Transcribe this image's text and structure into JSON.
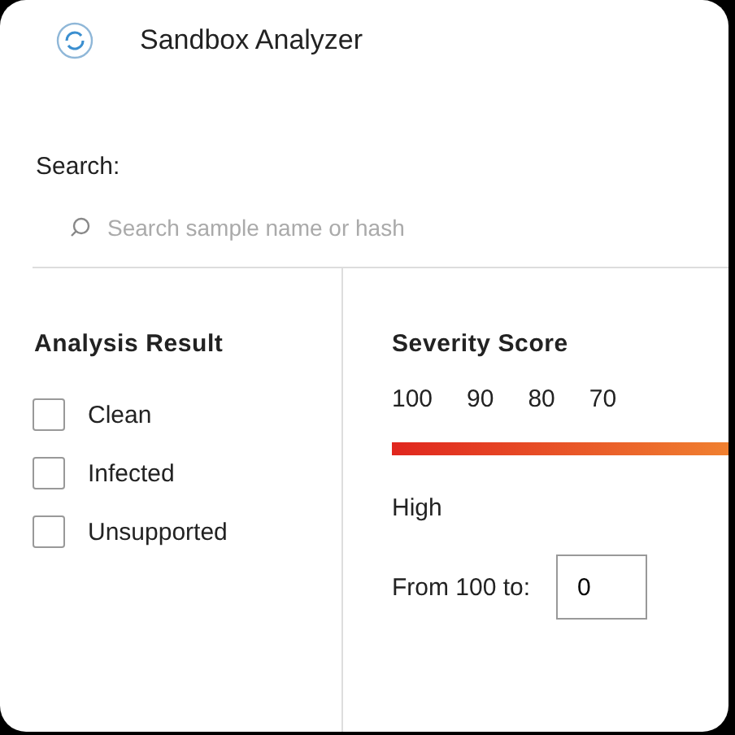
{
  "window": {
    "title": "Sandbox Analyzer"
  },
  "search": {
    "label": "Search:",
    "placeholder": "Search sample name or hash"
  },
  "analysis_result": {
    "title": "Analysis Result",
    "options": [
      {
        "label": "Clean",
        "checked": false
      },
      {
        "label": "Infected",
        "checked": false
      },
      {
        "label": "Unsupported",
        "checked": false
      }
    ]
  },
  "severity": {
    "title": "Severity Score",
    "ticks": [
      "100",
      "90",
      "80",
      "70"
    ],
    "level_label": "High",
    "range_label": "From 100 to:",
    "range_value": "0"
  }
}
